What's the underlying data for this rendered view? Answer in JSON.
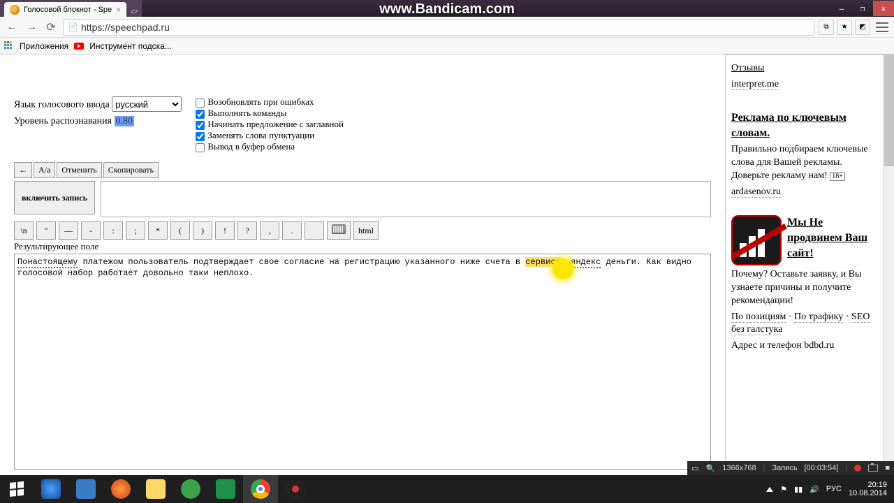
{
  "window": {
    "tab_title": "Голосовой блокнот - Spe"
  },
  "watermark": "www.Bandicam.com",
  "nav": {
    "url": "https://speechpad.ru"
  },
  "bookmarks": {
    "apps": "Приложения",
    "tool": "Инструмент подска..."
  },
  "settings": {
    "lang_label": "Язык голосового ввода",
    "lang_value": "русский",
    "level_label": "Уровень распознавания",
    "level_value": "0.80",
    "chk": {
      "resume": "Возобновлять при ошибках",
      "commands": "Выполнять команды",
      "capital": "Начинать предложение с заглавной",
      "replace": "Заменять слова пунктуации",
      "clipboard": "Вывод в буфер обмена"
    }
  },
  "edit_tb": {
    "back": "←",
    "case": "A/a",
    "undo": "Отменить",
    "copy": "Скопировать"
  },
  "record_btn": "включить запись",
  "sym": {
    "nl": "\\n",
    "q": "\"",
    "dash": "—",
    "hyph": "-",
    "colon": ":",
    "semi": ";",
    "star": "*",
    "lp": "(",
    "rp": ")",
    "excl": "!",
    "ques": "?",
    "comma": ",",
    "dot": ".",
    "space": " ",
    "kbd": "",
    "html": "html"
  },
  "result_label": "Результирующее поле",
  "result_text": {
    "w1": "Понастоящему",
    "p1": " платежом пользователь подтверждает свое согласие на регистрацию указанного ниже счета в ",
    "w2": "сервисе",
    "p2": ", ",
    "w3": "яндекс",
    "p3": " деньги. Как видно голосовой набор работает довольно таки неплохо."
  },
  "sidebar": {
    "reviews": "Отзывы",
    "interpret": "interpret.me",
    "ad1_title": "Реклама по ключевым словам.",
    "ad1_text": "Правильно подбираем ключевые слова для Вашей рекламы. Доверьте рекламу нам!",
    "ad1_badge": "18+",
    "ad1_domain": "ardasenov.ru",
    "ad2_title": "Мы Не продвинем Ваш сайт!",
    "ad2_text": "Почему? Оставьте заявку, и Вы узнаете причины и получите рекомендации!",
    "pos": "По позициям",
    "traf": "По трафику",
    "seo": "SEO без галстука",
    "ad2_domain": "Адрес и телефон  bdbd.ru"
  },
  "bandicam": {
    "res": "1366x768",
    "rec_label": "Запись",
    "time": "[00:03:54]"
  },
  "tray": {
    "lang": "РУС",
    "time": "20:19",
    "date": "10.08.2014"
  }
}
